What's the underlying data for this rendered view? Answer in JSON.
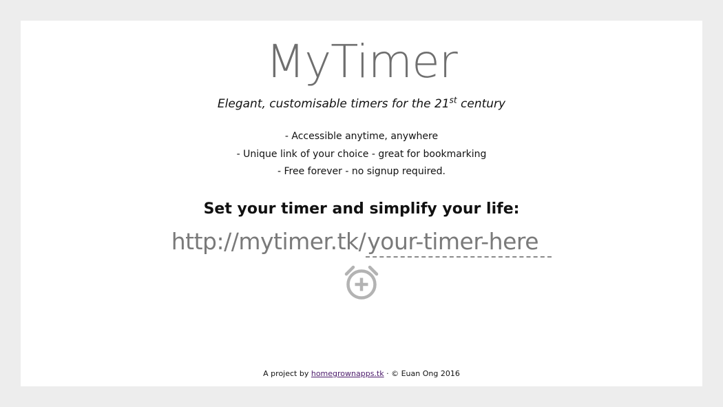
{
  "header": {
    "title": "MyTimer",
    "tagline_main": "Elegant, customisable timers for the 21",
    "tagline_sup": "st",
    "tagline_end": " century"
  },
  "features": [
    "- Accessible anytime, anywhere",
    "- Unique link of your choice - great for bookmarking",
    "- Free forever - no signup required."
  ],
  "cta": {
    "heading": "Set your timer and simplify your life:",
    "url_prefix": "http://mytimer.tk/",
    "input_placeholder": "your-timer-here",
    "input_value": ""
  },
  "add_button": {
    "icon": "add-alarm-icon"
  },
  "footer": {
    "prefix": "A project by ",
    "link_text": "homegrownapps.tk",
    "suffix": " · © Euan Ong 2016"
  },
  "colors": {
    "page_background": "#ededed",
    "card_background": "#ffffff",
    "title_gray": "#6f6f6f",
    "icon_gray": "#b3b3b3",
    "link_purple": "#4b1a6b"
  }
}
